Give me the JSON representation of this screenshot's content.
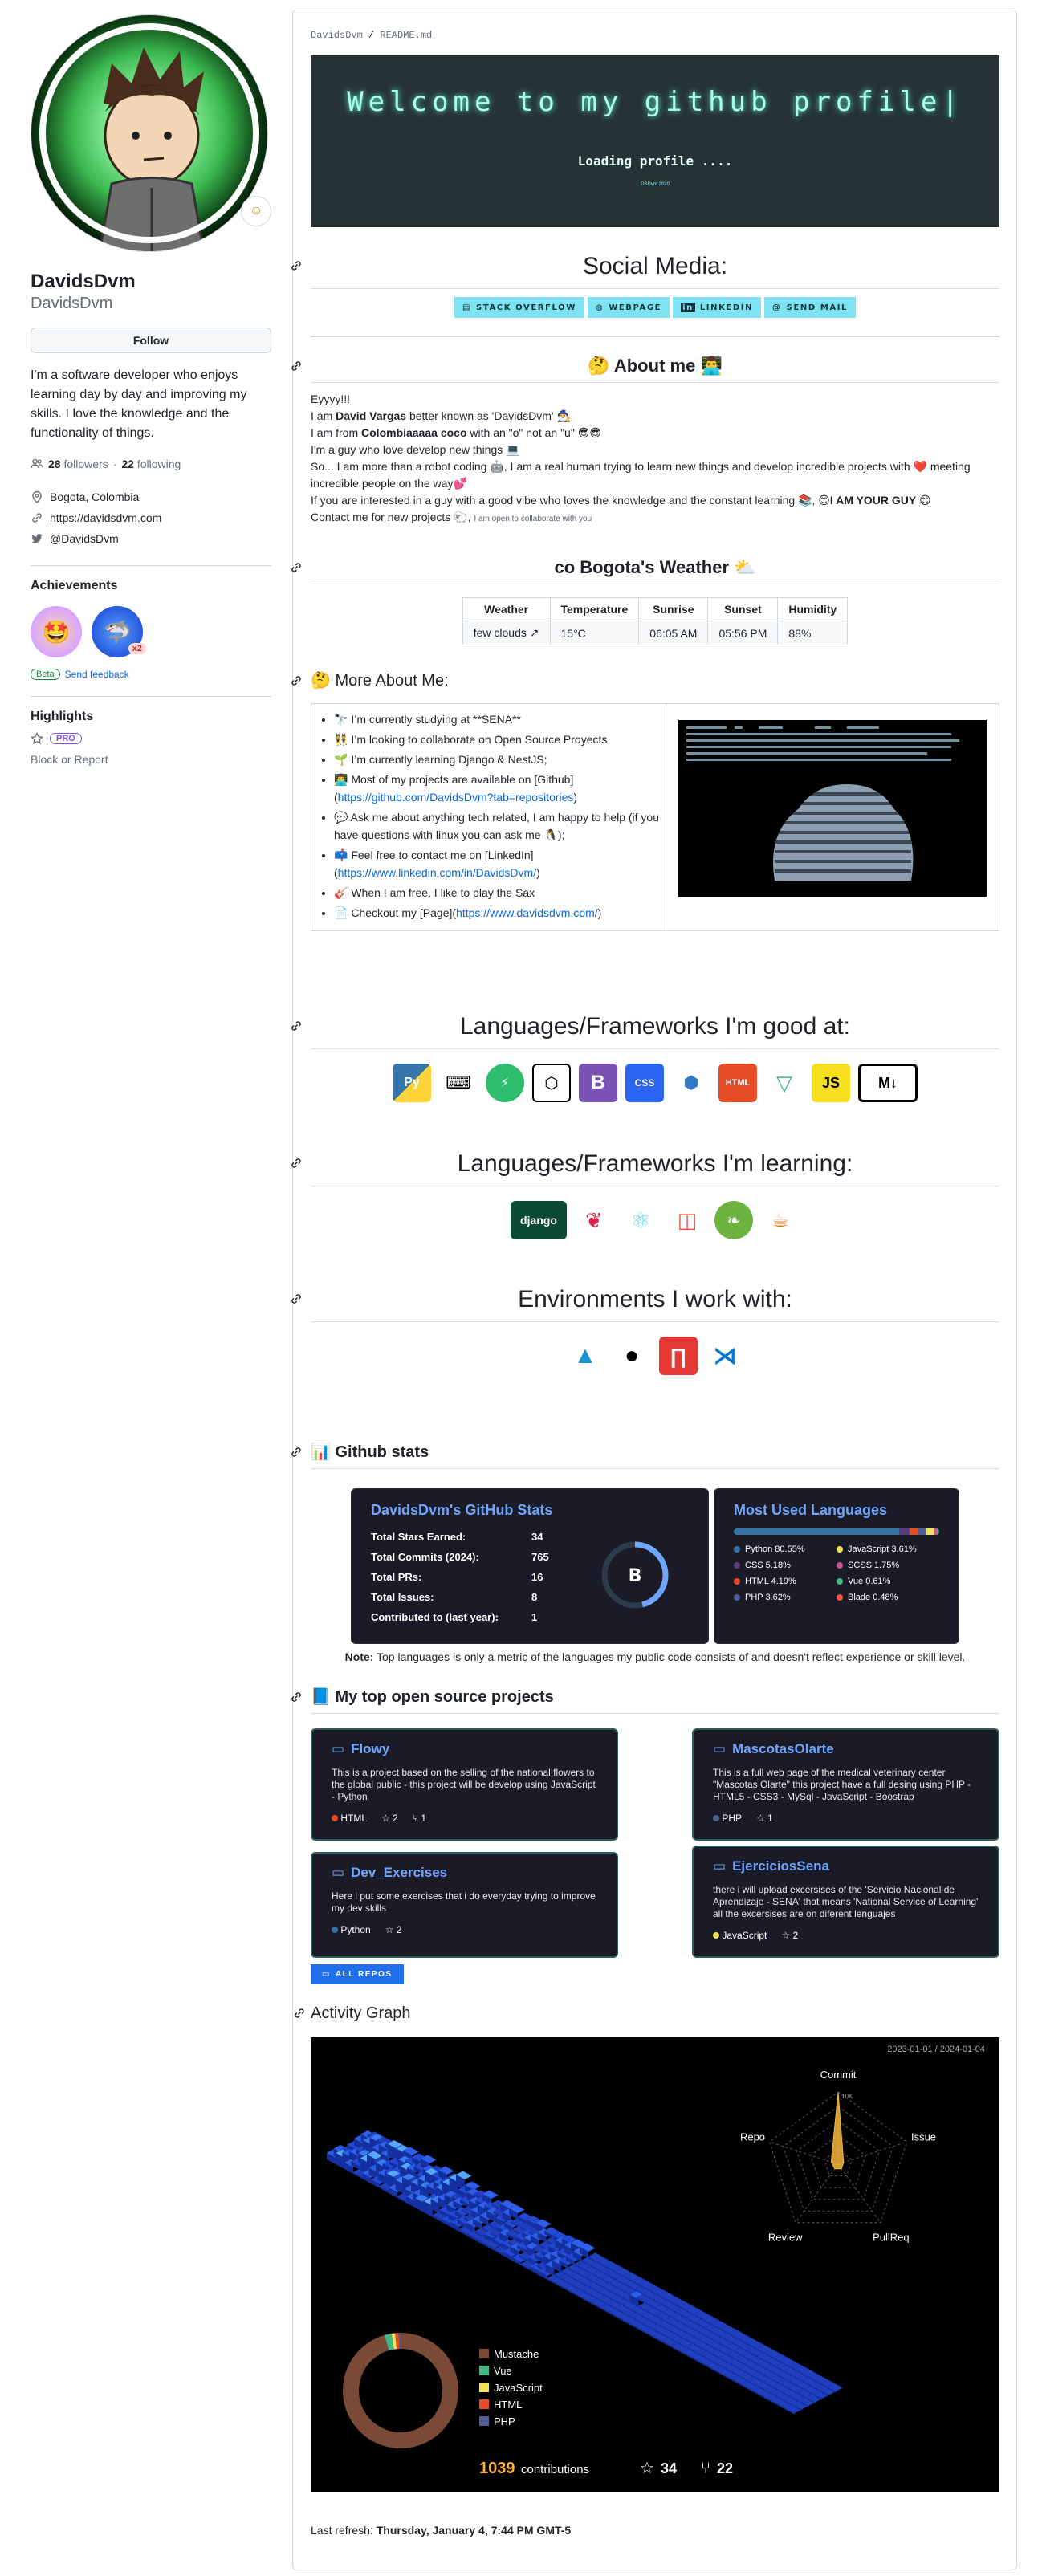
{
  "profile": {
    "name": "DavidsDvm",
    "login": "DavidsDvm",
    "follow_label": "Follow",
    "bio": "I'm a software developer who enjoys learning day by day and improving my skills. I love the knowledge and the functionality of things.",
    "followers": "28",
    "followers_label": "followers",
    "following": "22",
    "following_label": "following",
    "location": "Bogota, Colombia",
    "website": "https://davidsdvm.com",
    "twitter": "@DavidsDvm",
    "achievements_title": "Achievements",
    "achievement_count": "x2",
    "beta": "Beta",
    "feedback": "Send feedback",
    "highlights_title": "Highlights",
    "pro": "PRO",
    "block": "Block or Report"
  },
  "readme": {
    "crumb_user": "DavidsDvm",
    "crumb_file": "README.md",
    "banner_title": "Welcome to my github profile|",
    "banner_sub": "Loading profile ....",
    "banner_mini": "DSDvm 2020",
    "social_title": "Social Media:",
    "social": [
      "STACK OVERFLOW",
      "WEBPAGE",
      "LINKEDIN",
      "SEND MAIL"
    ],
    "about_title": "About me",
    "about_lines": {
      "l1": "Eyyyy!!!",
      "l2a": "I am ",
      "l2b": "David Vargas",
      "l2c": " better known as 'DavidsDvm' 🧙‍♂️",
      "l3a": "I am from ",
      "l3b": "Colombiaaaaa coco",
      "l3c": " with an \"o\" not an \"u\" 😎😎",
      "l4": "I'm a guy who love develop new things 💻",
      "l5": "So... I am more than a robot coding 🤖, I am a real human trying to learn new things and develop incredible projects with ❤️ meeting incredible people on the way💕",
      "l6a": "If you are interested in a guy with a good vibe who loves the knowledge and the constant learning 📚, 😊",
      "l6b": "I AM YOUR GUY",
      "l6c": " 😊",
      "l7a": "Contact me for new projects 🐑,",
      "l7b": "I am open to collaborate with you"
    },
    "weather_title": "Bogota's Weather",
    "weather_headers": [
      "Weather",
      "Temperature",
      "Sunrise",
      "Sunset",
      "Humidity"
    ],
    "weather_row": [
      "few clouds ↗",
      "15°C",
      "06:05 AM",
      "05:56 PM",
      "88%"
    ],
    "more_title": "More About Me:",
    "more_items": [
      "🔭 I’m currently studying at **SENA**",
      "👯 I’m looking to collaborate on Open Source Proyects",
      "🌱 I’m currently learning Django & NestJS;",
      "👨‍💻 Most of my projects are available on [Github](",
      "💬 Ask me about anything tech related, I am happy to help (if you have questions with linux you can ask me 🐧);",
      "📫 Feel free to contact me on [LinkedIn](",
      "🎸 When I am free, I like to play the Sax",
      "📄 Checkout my [Page]("
    ],
    "more_links": {
      "github": "https://github.com/DavidsDvm?tab=repositories",
      "linkedin": "https://www.linkedin.com/in/DavidsDvm/",
      "page": "https://www.davidsdvm.com/"
    },
    "good_title": "Languages/Frameworks I'm good at:",
    "learning_title": "Languages/Frameworks I'm learning:",
    "env_title": "Environments I work with:",
    "stats_title": "Github stats",
    "stats_card_title": "DavidsDvm's GitHub Stats",
    "stats": [
      {
        "label": "Total Stars Earned:",
        "value": "34"
      },
      {
        "label": "Total Commits (2024):",
        "value": "765"
      },
      {
        "label": "Total PRs:",
        "value": "16"
      },
      {
        "label": "Total Issues:",
        "value": "8"
      },
      {
        "label": "Contributed to (last year):",
        "value": "1"
      }
    ],
    "grade": "B",
    "langs_title": "Most Used Languages",
    "langs": [
      {
        "name": "Python 80.55%",
        "color": "#3572A5",
        "pct": 80.55
      },
      {
        "name": "JavaScript 3.61%",
        "color": "#f1e05a",
        "pct": 3.61
      },
      {
        "name": "CSS 5.18%",
        "color": "#563d7c",
        "pct": 5.18
      },
      {
        "name": "SCSS 1.75%",
        "color": "#c6538c",
        "pct": 1.75
      },
      {
        "name": "HTML 4.19%",
        "color": "#e34c26",
        "pct": 4.19
      },
      {
        "name": "Vue 0.61%",
        "color": "#41b883",
        "pct": 0.61
      },
      {
        "name": "PHP 3.62%",
        "color": "#4F5D95",
        "pct": 3.62
      },
      {
        "name": "Blade 0.48%",
        "color": "#f7523f",
        "pct": 0.48
      }
    ],
    "note_bold": "Note:",
    "note_text": " Top languages is only a metric of the languages my public code consists of and doesn't reflect experience or skill level.",
    "projects_title": "My top open source projects",
    "repos": [
      {
        "name": "Flowy",
        "desc": "This is a project based on the selling of the national flowers to the global public - this project will be develop using JavaScript - Python",
        "lang": "HTML",
        "color": "#e34c26",
        "stars": "2",
        "forks": "1"
      },
      {
        "name": "MascotasOlarte",
        "desc": "This is a full web page of the medical veterinary center \"Mascotas Olarte\" this project have a full desing using PHP - HTML5 - CSS3 - MySql - JavaScript - Boostrap",
        "lang": "PHP",
        "color": "#4F5D95",
        "stars": "1",
        "forks": ""
      },
      {
        "name": "Dev_Exercises",
        "desc": "Here i put some exercises that i do everyday trying to improve my dev skills",
        "lang": "Python",
        "color": "#3572A5",
        "stars": "2",
        "forks": ""
      },
      {
        "name": "EjerciciosSena",
        "desc": "there i will upload excersises of the 'Servicio Nacional de Aprendizaje - SENA' that means 'National Service of Learning' all the excersises are on diferent lenguajes",
        "lang": "JavaScript",
        "color": "#f1e05a",
        "stars": "2",
        "forks": ""
      }
    ],
    "all_repos": "ALL REPOS",
    "activity_title": "Activity Graph",
    "activity_range": "2023-01-01 / 2024-01-04",
    "radar_labels": [
      "Commit",
      "Issue",
      "PullReq",
      "Review",
      "Repo"
    ],
    "radar_values": [
      1.0,
      0.02,
      0.05,
      0.02,
      0.1
    ],
    "radar_tick": "10K",
    "donut_legend": [
      {
        "name": "Mustache",
        "color": "#7b4a36"
      },
      {
        "name": "Vue",
        "color": "#41b883"
      },
      {
        "name": "JavaScript",
        "color": "#f1e05a"
      },
      {
        "name": "HTML",
        "color": "#e34c26"
      },
      {
        "name": "PHP",
        "color": "#4F5D95"
      }
    ],
    "contributions": "1039",
    "contributions_label": "contributions",
    "act_stars": "34",
    "act_forks": "22",
    "refresh_label": "Last refresh:",
    "refresh_value": "Thursday, January 4, 7:44 PM GMT-5"
  }
}
